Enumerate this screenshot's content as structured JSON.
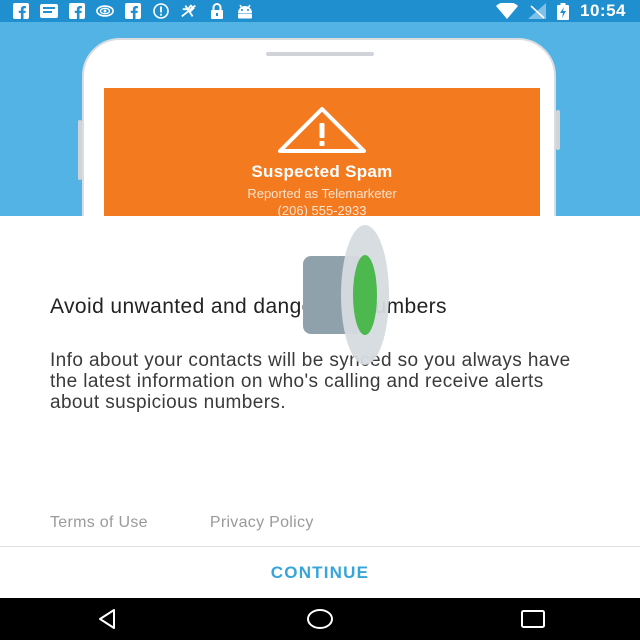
{
  "status_bar": {
    "time": "10:54",
    "left_icons": [
      "facebook-icon",
      "message-icon",
      "facebook-icon",
      "eye-icon",
      "facebook-icon",
      "info-icon",
      "no-location-icon",
      "lock-icon",
      "android-icon"
    ],
    "right_icons": [
      "wifi-icon",
      "no-signal-icon",
      "battery-charging-icon"
    ]
  },
  "hero": {
    "card_title": "Suspected Spam",
    "card_subtitle": "Reported as Telemarketer",
    "card_number": "(206) 555-2933",
    "card_color": "#f47a20",
    "background_color": "#53b3e5"
  },
  "content": {
    "headline": "Avoid unwanted and dangerous numbers",
    "body": "Info about your contacts will be synced so you always have the latest information on who's calling and receive alerts about suspicious numbers."
  },
  "links": {
    "terms": "Terms of Use",
    "privacy": "Privacy Policy"
  },
  "actions": {
    "continue_label": "CONTINUE",
    "accent_color": "#37a4da"
  },
  "nav_bar": {
    "buttons": [
      "back-icon",
      "home-icon",
      "recents-icon"
    ]
  }
}
